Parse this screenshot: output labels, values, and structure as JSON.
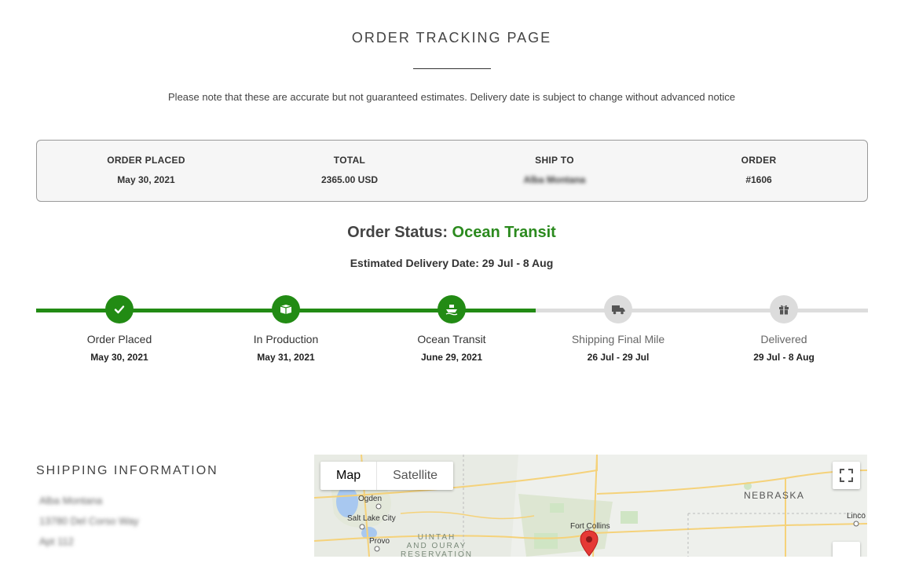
{
  "header": {
    "title": "ORDER TRACKING PAGE",
    "notice": "Please note that these are accurate but not guaranteed estimates. Delivery date is subject to change without advanced notice"
  },
  "summary": {
    "order_placed": {
      "label": "ORDER PLACED",
      "value": "May 30, 2021"
    },
    "total": {
      "label": "TOTAL",
      "value": "2365.00 USD"
    },
    "ship_to": {
      "label": "SHIP TO",
      "value": "Alba Montana"
    },
    "order": {
      "label": "ORDER",
      "value": "#1606"
    }
  },
  "status": {
    "prefix": "Order Status: ",
    "value": "Ocean Transit",
    "estimated_delivery": "Estimated Delivery Date: 29 Jul - 8 Aug"
  },
  "progress": {
    "completed_fraction": 0.6,
    "steps": [
      {
        "label": "Order Placed",
        "date": "May 30, 2021",
        "done": true,
        "icon": "check-icon"
      },
      {
        "label": "In Production",
        "date": "May 31, 2021",
        "done": true,
        "icon": "box-icon"
      },
      {
        "label": "Ocean Transit",
        "date": "June 29, 2021",
        "done": true,
        "icon": "ship-icon"
      },
      {
        "label": "Shipping Final Mile",
        "date": "26 Jul - 29 Jul",
        "done": false,
        "icon": "truck-icon"
      },
      {
        "label": "Delivered",
        "date": "29 Jul - 8 Aug",
        "done": false,
        "icon": "gift-icon"
      }
    ]
  },
  "shipping": {
    "heading": "SHIPPING INFORMATION",
    "lines": [
      "Alba Montana",
      "13780 Del Corso Way",
      "Apt 112"
    ]
  },
  "map": {
    "tabs": [
      "Map",
      "Satellite"
    ],
    "active_tab": "Map",
    "labels": {
      "nebraska": "NEBRASKA",
      "ogden": "Ogden",
      "salt_lake_city": "Salt Lake City",
      "provo": "Provo",
      "fort_collins": "Fort Collins",
      "lincoln": "Linco",
      "reservation_1": "UINTAH",
      "reservation_2": "AND OURAY",
      "reservation_3": "RESERVATION"
    },
    "colors": {
      "marker": "#e53935",
      "road": "#f5d27a",
      "park": "#cfe5c4",
      "water": "#a8c8f0"
    }
  },
  "colors": {
    "accent": "#228b14",
    "pending": "#dcdcdc"
  }
}
